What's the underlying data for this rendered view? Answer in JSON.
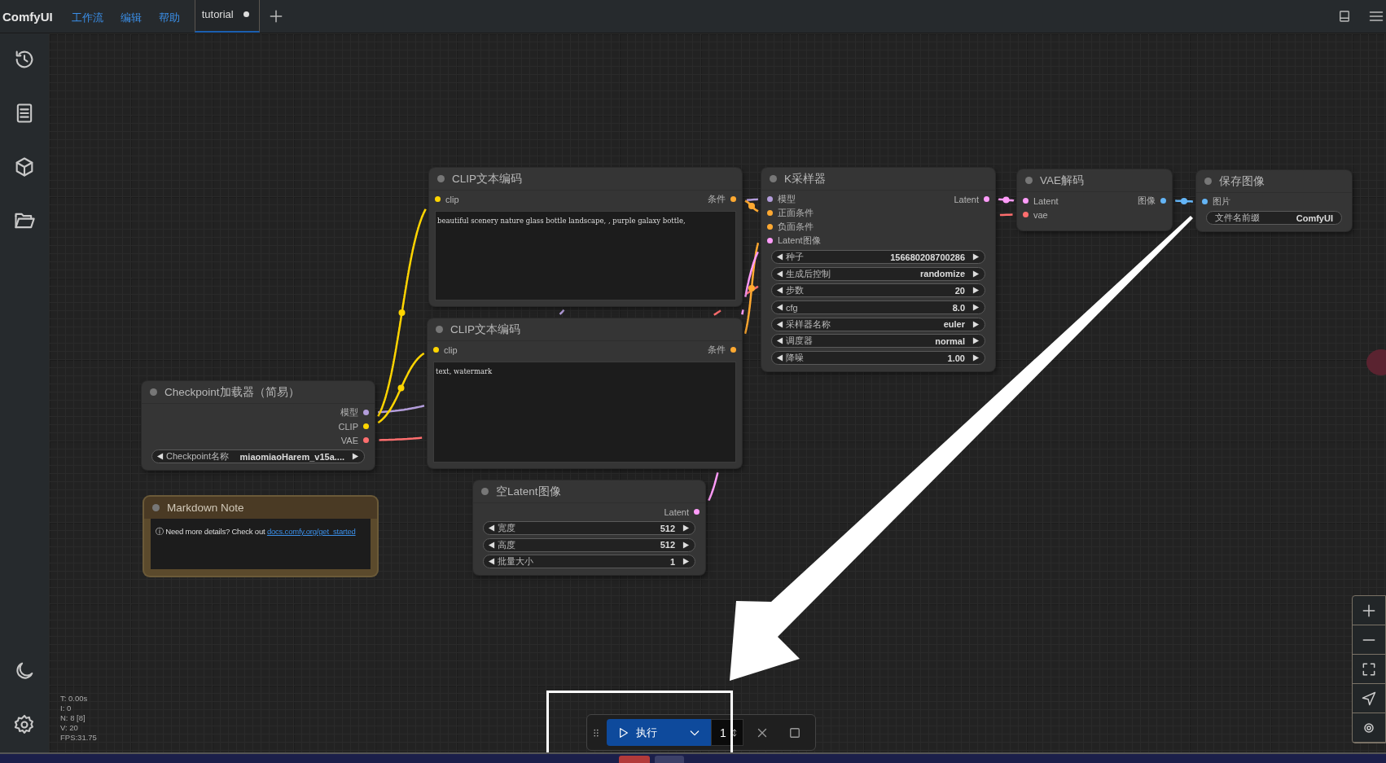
{
  "topbar": {
    "logo": "ComfyUI",
    "menus": [
      "工作流",
      "编辑",
      "帮助"
    ],
    "tabs": [
      {
        "label": "tutorial",
        "selected": true,
        "modified": true
      }
    ]
  },
  "nodes": [
    {
      "kind": "node",
      "title": "CLIP文本编码",
      "inputs": [
        {
          "label": "clip",
          "color": "#ffd500"
        }
      ],
      "outputs": [
        {
          "label": "条件",
          "color": "#ffa931"
        }
      ],
      "widgets": [
        {
          "kind": "textarea",
          "value": "beautiful scenery nature glass bottle landscape, , purple galaxy bottle,"
        }
      ]
    },
    {
      "kind": "node",
      "title": "K采样器",
      "inputs": [
        {
          "label": "模型",
          "color": "#b39ddb"
        },
        {
          "label": "正面条件",
          "color": "#ffa931"
        },
        {
          "label": "负面条件",
          "color": "#ffa931"
        },
        {
          "label": "Latent图像",
          "color": "#ff9cf9"
        }
      ],
      "outputs": [
        {
          "label": "Latent",
          "color": "#ff9cf9"
        }
      ],
      "widgets": [
        {
          "kind": "stepper",
          "label": "种子",
          "value": "156680208700286"
        },
        {
          "kind": "stepper",
          "label": "生成后控制",
          "value": "randomize"
        },
        {
          "kind": "stepper",
          "label": "步数",
          "value": "20"
        },
        {
          "kind": "stepper",
          "label": "cfg",
          "value": "8.0"
        },
        {
          "kind": "stepper",
          "label": "采样器名称",
          "value": "euler"
        },
        {
          "kind": "stepper",
          "label": "调度器",
          "value": "normal"
        },
        {
          "kind": "stepper",
          "label": "降噪",
          "value": "1.00"
        }
      ]
    },
    {
      "kind": "node",
      "title": "VAE解码",
      "inputs": [
        {
          "label": "Latent",
          "color": "#ff9cf9"
        },
        {
          "label": "vae",
          "color": "#ff6e6e"
        }
      ],
      "outputs": [
        {
          "label": "图像",
          "color": "#64b5f6"
        }
      ]
    },
    {
      "kind": "node",
      "title": "保存图像",
      "inputs": [
        {
          "label": "图片",
          "color": "#64b5f6"
        }
      ],
      "widgets": [
        {
          "kind": "text",
          "label": "文件名前缀",
          "value": "ComfyUI"
        }
      ]
    },
    {
      "kind": "node",
      "title": "CLIP文本编码",
      "inputs": [
        {
          "label": "clip",
          "color": "#ffd500"
        }
      ],
      "outputs": [
        {
          "label": "条件",
          "color": "#ffa931"
        }
      ],
      "widgets": [
        {
          "kind": "textarea",
          "value": "text, watermark"
        }
      ]
    },
    {
      "kind": "node",
      "title": "Checkpoint加载器（简易）",
      "outputs": [
        {
          "label": "模型",
          "color": "#b39ddb"
        },
        {
          "label": "CLIP",
          "color": "#ffd500"
        },
        {
          "label": "VAE",
          "color": "#ff6e6e"
        }
      ],
      "widgets": [
        {
          "kind": "stepper",
          "label": "Checkpoint名称",
          "value": "miaomiaoHarem_v15a...."
        }
      ]
    },
    {
      "kind": "node",
      "title": "空Latent图像",
      "outputs": [
        {
          "label": "Latent",
          "color": "#ff9cf9"
        }
      ],
      "widgets": [
        {
          "kind": "stepper",
          "label": "宽度",
          "value": "512"
        },
        {
          "kind": "stepper",
          "label": "高度",
          "value": "512"
        },
        {
          "kind": "stepper",
          "label": "批量大小",
          "value": "1"
        }
      ]
    },
    {
      "kind": "note",
      "title": "Markdown Note",
      "text": "ⓘ Need more details? Check out ",
      "link": "docs.comfy.org/get_started"
    }
  ],
  "stats": [
    "T: 0.00s",
    "I: 0",
    "N: 8 [8]",
    "V: 20",
    "FPS:31.75"
  ],
  "run_toolbar": {
    "run_label": "执行",
    "batch_count": "1"
  }
}
